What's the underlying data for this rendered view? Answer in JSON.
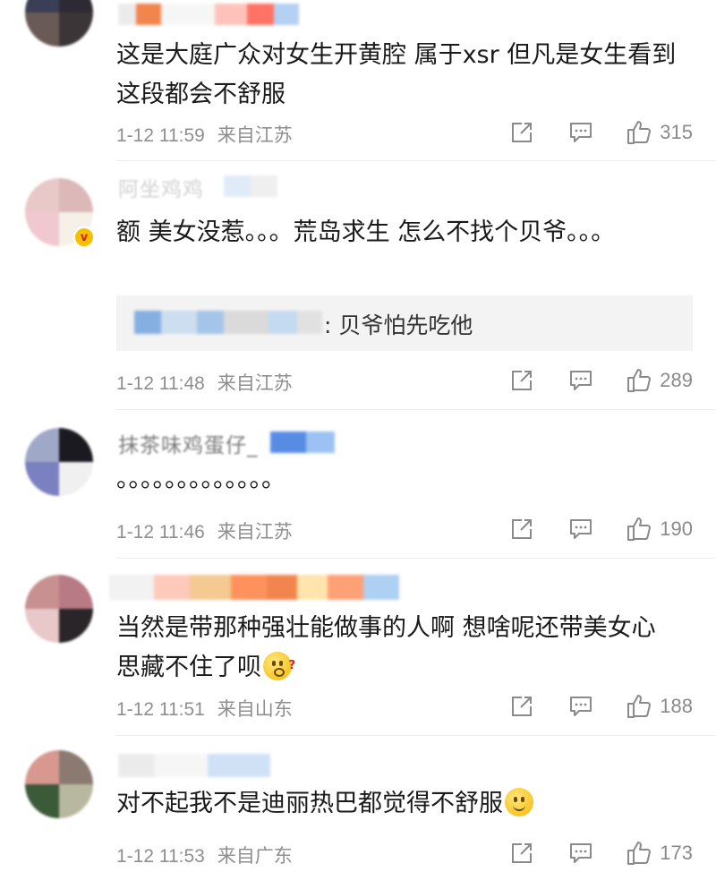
{
  "comments": [
    {
      "text": "这是大庭广众对女生开黄腔 属于xsr 但凡是女生看到这段都会不舒服",
      "time": "1-12 11:59",
      "location": "来自江苏",
      "likes": "315",
      "avatar_colors": [
        "#3a3f55",
        "#2d2a35",
        "#6a5a55",
        "#3b3538"
      ],
      "name_colors": [
        "#e8e8e8",
        "#f07030",
        "#f5f5f5",
        "#ffb8b0",
        "#ff5a4a",
        "#a8c8f0"
      ]
    },
    {
      "text": "额 美女没惹。。。荒岛求生 怎么不找个贝爷。。。",
      "reply_text": ": 贝爷怕先吃他",
      "time": "1-12 11:48",
      "location": "来自江苏",
      "likes": "289",
      "verified_mark": "v",
      "name_text": "阿坐鸡鸡",
      "avatar_colors": [
        "#e8c8c8",
        "#dcb8b8",
        "#f0c8d0",
        "#f5f0e8"
      ],
      "name_colors": [
        "#c0d8f0",
        "#e0e0e0",
        "#7aa8e0",
        "#c8dcf0",
        "#9cc0e8",
        "#d8d8d8"
      ]
    },
    {
      "text": "。。。。。。。。。。。。。",
      "time": "1-12 11:46",
      "location": "来自江苏",
      "likes": "190",
      "name_text": "抹茶味鸡蛋仔_",
      "avatar_colors": [
        "#a0a8c8",
        "#1a1a20",
        "#7a80c0",
        "#f0f0f0"
      ],
      "name_colors": [
        "#3a78e0",
        "#8ab8f0"
      ]
    },
    {
      "text": "当然是带那种强壮能做事的人啊 想啥呢还带美女心思藏不住了呗",
      "time": "1-12 11:51",
      "location": "来自山东",
      "likes": "188",
      "avatar_colors": [
        "#c89090",
        "#b87a85",
        "#e8c8c8",
        "#2a2528"
      ],
      "name_colors": [
        "#f0f0f0",
        "#ffc0b0",
        "#f3c080",
        "#ff8040",
        "#f07030",
        "#ffe0a0",
        "#ff9060",
        "#a0c8f0"
      ]
    },
    {
      "text": "对不起我不是迪丽热巴都觉得不舒服",
      "time": "1-12 11:53",
      "location": "来自广东",
      "likes": "173",
      "avatar_colors": [
        "#d89890",
        "#8a7a70",
        "#3a5a38",
        "#b8b8a0"
      ],
      "name_colors": [
        "#e8e8e8",
        "#f5f5f5",
        "#c8dcf5"
      ]
    }
  ],
  "icons": {
    "share": "share-icon",
    "comment": "comment-icon",
    "like": "like-icon"
  },
  "colors": {
    "meta": "#8f8f8f",
    "body": "#1a1a1a",
    "reply_bg": "#f3f3f3"
  }
}
